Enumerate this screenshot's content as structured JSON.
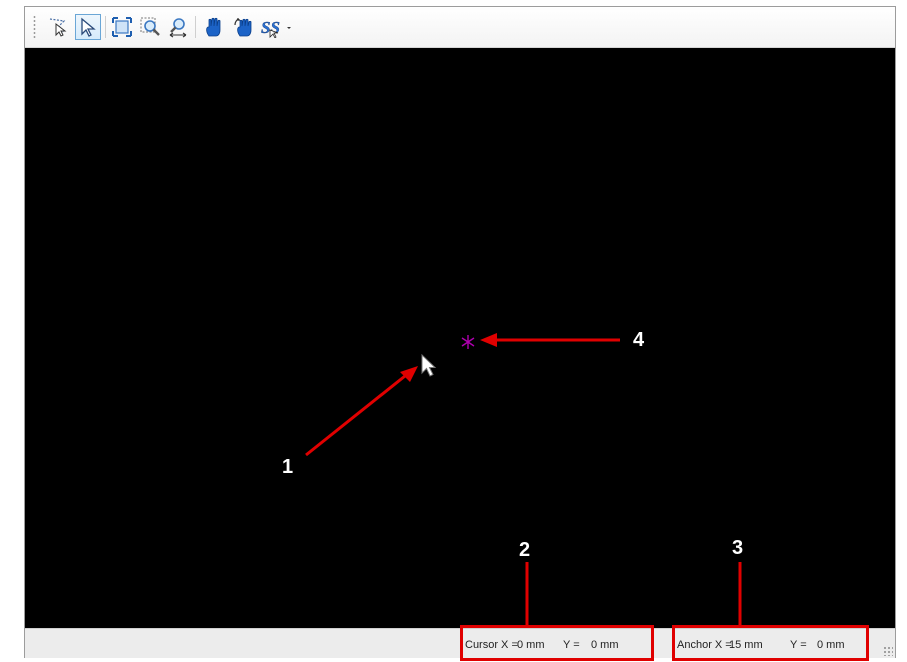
{
  "toolbar": {
    "tools": [
      {
        "name": "lasso-select-tool"
      },
      {
        "name": "pointer-select-tool",
        "active": true
      },
      {
        "name": "zoom-fit-tool"
      },
      {
        "name": "zoom-window-tool"
      },
      {
        "name": "zoom-pan-tool"
      },
      {
        "name": "pan-hand-tool"
      },
      {
        "name": "rotate-hand-tool"
      },
      {
        "name": "snap-dropdown-tool",
        "has_dropdown": true
      }
    ]
  },
  "canvas": {
    "background": "#000000",
    "anchor_marker_color": "#b000b0",
    "cursor_color": "#ffffff"
  },
  "status": {
    "cursor_label": "Cursor X =",
    "cursor_x": "0 mm",
    "cursor_y_label": "Y =",
    "cursor_y": "0 mm",
    "anchor_label": "Anchor X =",
    "anchor_x": "15 mm",
    "anchor_y_label": "Y =",
    "anchor_y": "0 mm"
  },
  "annotations": {
    "color": "#e00000",
    "callouts": [
      "1",
      "2",
      "3",
      "4"
    ]
  }
}
